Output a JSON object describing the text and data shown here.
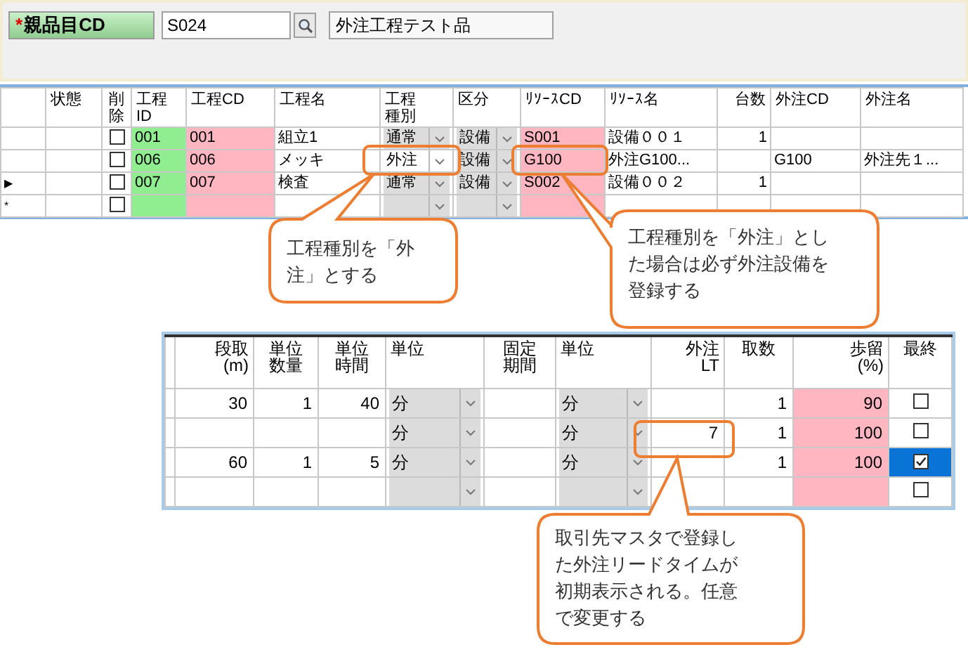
{
  "header": {
    "required_mark": "*",
    "label": "親品目CD",
    "code": "S024",
    "item_name": "外注工程テスト品"
  },
  "process_grid": {
    "columns": [
      {
        "lines": [
          "状態"
        ]
      },
      {
        "lines": [
          "削",
          "除"
        ]
      },
      {
        "lines": [
          "工程",
          "ID"
        ]
      },
      {
        "lines": [
          "工程CD"
        ]
      },
      {
        "lines": [
          "工程名"
        ]
      },
      {
        "lines": [
          "工程",
          "種別"
        ]
      },
      {
        "lines": [
          "区分"
        ]
      },
      {
        "lines": [
          "ﾘｿｰｽCD"
        ]
      },
      {
        "lines": [
          "ﾘｿｰｽ名"
        ]
      },
      {
        "lines": [
          "台数"
        ]
      },
      {
        "lines": [
          "外注CD"
        ]
      },
      {
        "lines": [
          "外注名"
        ]
      }
    ],
    "rows": [
      {
        "marker": "",
        "status": "",
        "deleted": false,
        "process_id": "001",
        "process_cd": "001",
        "process_name": "組立1",
        "process_type": "通常",
        "division": "設備",
        "resource_cd": "S001",
        "resource_name": "設備００１",
        "units": "1",
        "outsource_cd": "",
        "outsource_name": ""
      },
      {
        "marker": "",
        "status": "",
        "deleted": false,
        "process_id": "006",
        "process_cd": "006",
        "process_name": "メッキ",
        "process_type": "外注",
        "division": "設備",
        "resource_cd": "G100",
        "resource_name": "外注G100...",
        "units": "",
        "outsource_cd": "G100",
        "outsource_name": "外注先１..."
      },
      {
        "marker": "▶",
        "status": "",
        "deleted": false,
        "process_id": "007",
        "process_cd": "007",
        "process_name": "検査",
        "process_type": "通常",
        "division": "設備",
        "resource_cd": "S002",
        "resource_name": "設備００２",
        "units": "1",
        "outsource_cd": "",
        "outsource_name": ""
      },
      {
        "marker": "*",
        "status": "",
        "deleted": false,
        "process_id": "",
        "process_cd": "",
        "process_name": "",
        "process_type": "",
        "division": "",
        "resource_cd": "",
        "resource_name": "",
        "units": "",
        "outsource_cd": "",
        "outsource_name": ""
      }
    ]
  },
  "detail_grid": {
    "columns": [
      {
        "lines": [
          "段取",
          "(m)"
        ]
      },
      {
        "lines": [
          "単位",
          "数量"
        ]
      },
      {
        "lines": [
          "単位",
          "時間"
        ]
      },
      {
        "lines": [
          "単位"
        ]
      },
      {
        "lines": [
          "固定",
          "期間"
        ]
      },
      {
        "lines": [
          "単位"
        ]
      },
      {
        "lines": [
          "外注",
          "LT"
        ]
      },
      {
        "lines": [
          "取数"
        ]
      },
      {
        "lines": [
          "歩留",
          "(%)"
        ]
      },
      {
        "lines": [
          "最終"
        ]
      }
    ],
    "rows": [
      {
        "setup": "30",
        "unit_qty": "1",
        "unit_time": "40",
        "unit": "分",
        "fixed_period": "",
        "period_unit": "分",
        "outsource_lt": "",
        "take_count": "1",
        "yield": "90",
        "final": false,
        "selected": false
      },
      {
        "setup": "",
        "unit_qty": "",
        "unit_time": "",
        "unit": "分",
        "fixed_period": "",
        "period_unit": "分",
        "outsource_lt": "7",
        "take_count": "1",
        "yield": "100",
        "final": false,
        "selected": false
      },
      {
        "setup": "60",
        "unit_qty": "1",
        "unit_time": "5",
        "unit": "分",
        "fixed_period": "",
        "period_unit": "分",
        "outsource_lt": "",
        "take_count": "1",
        "yield": "100",
        "final": true,
        "selected": true
      },
      {
        "setup": "",
        "unit_qty": "",
        "unit_time": "",
        "unit": "",
        "fixed_period": "",
        "period_unit": "",
        "outsource_lt": "",
        "take_count": "",
        "yield": "",
        "final": false,
        "selected": false
      }
    ]
  },
  "callouts": [
    {
      "text": "工程種別を「外注」とする"
    },
    {
      "text": "工程種別を「外注」とした場合は必ず外注設備を登録する"
    },
    {
      "text": "取引先マスタで登録した外注リードタイムが初期表示される。任意で変更する"
    }
  ]
}
